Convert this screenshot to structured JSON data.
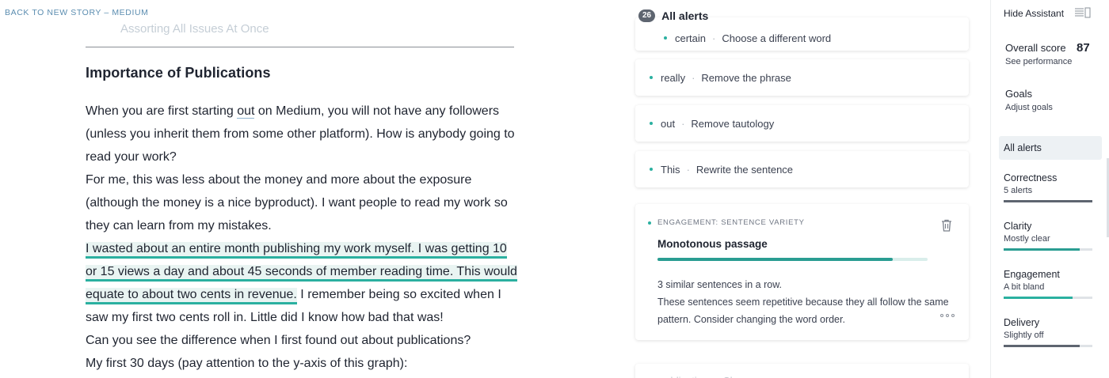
{
  "top": {
    "back_link": "BACK TO NEW STORY – MEDIUM"
  },
  "editor": {
    "faded_line": "Assorting All Issues At Once",
    "heading": "Importance of Publications",
    "p1_before": "When you are first starting ",
    "p1_under": "out",
    "p1_after": " on Medium, you will not have any followers (unless you inherit them from some other platform). How is anybody going to read your work?",
    "p2": "For me, this was less about the money and more about the exposure (although the money is a nice byproduct). I want people to read my work so they can learn from my mistakes.",
    "p3_highlight": "I wasted about an entire month publishing my work myself. I was getting 10 or 15 views a day and about 45 seconds of member reading time. This would equate to about two cents in revenue.",
    "p3_rest": " I remember being so excited when I saw my first two cents roll in. Little did I know how bad that was!",
    "p4": "Can you see the difference when I first found out about publications?",
    "p5": "My first 30 days (pay attention to the y-axis of this graph):"
  },
  "alerts": {
    "count": "26",
    "title": "All alerts",
    "items": [
      {
        "word": "certain",
        "suggestion": "Choose a different word"
      },
      {
        "word": "really",
        "suggestion": "Remove the phrase"
      },
      {
        "word": "out",
        "suggestion": "Remove tautology"
      },
      {
        "word": "This",
        "suggestion": "Rewrite the sentence"
      }
    ],
    "expanded": {
      "category": "ENGAGEMENT: SENTENCE VARIETY",
      "title": "Monotonous passage",
      "progress": 0.87,
      "line1": "3 similar sentences in a row.",
      "line2": "These sentences seem repetitive because they all follow the same pattern. Consider changing the word order."
    },
    "bottom_peek": "publications · Ch..."
  },
  "sidebar": {
    "hide_assistant": "Hide Assistant",
    "overall_label": "Overall score",
    "overall_value": "87",
    "see_performance": "See performance",
    "goals_label": "Goals",
    "adjust_goals": "Adjust goals",
    "all_alerts": "All alerts",
    "categories": [
      {
        "name": "Correctness",
        "sub": "5 alerts",
        "fill": 1.0,
        "color": "#5e6570"
      },
      {
        "name": "Clarity",
        "sub": "Mostly clear",
        "fill": 0.86,
        "color": "#2a9d92"
      },
      {
        "name": "Engagement",
        "sub": "A bit bland",
        "fill": 0.78,
        "color": "#2bb0a0"
      },
      {
        "name": "Delivery",
        "sub": "Slightly off",
        "fill": 0.86,
        "color": "#5e6570"
      }
    ]
  }
}
